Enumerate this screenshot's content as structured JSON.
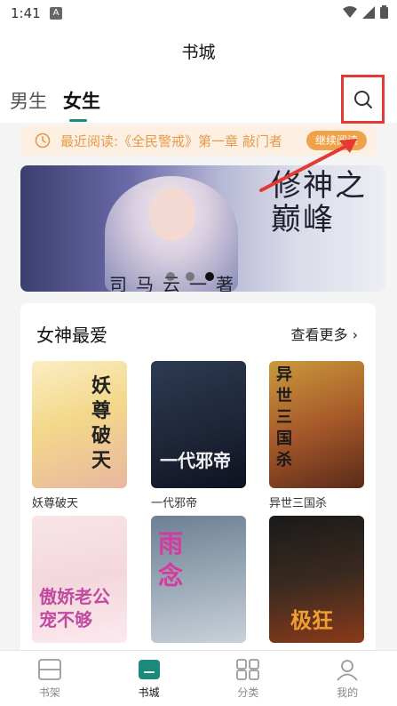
{
  "status_bar": {
    "time": "1:41",
    "badge": "A"
  },
  "header": {
    "title": "书城"
  },
  "tabs": [
    {
      "label": "男生"
    },
    {
      "label": "女生"
    }
  ],
  "recent": {
    "text": "最近阅读:《全民警戒》第一章 敲门者",
    "continue_label": "继续阅读"
  },
  "banner": {
    "title_vertical": "修神之巅峰",
    "author": "司马云一著"
  },
  "section": {
    "title": "女神最爱",
    "more_label": "查看更多",
    "books": [
      {
        "name": "妖尊破天",
        "cover_text": "妖尊破天"
      },
      {
        "name": "一代邪帝",
        "cover_text": "一代邪帝"
      },
      {
        "name": "异世三国杀",
        "cover_text": "异世三国杀"
      },
      {
        "name": "",
        "cover_text": "傲娇老公宠不够"
      },
      {
        "name": "",
        "cover_text": "雨念"
      },
      {
        "name": "",
        "cover_text": "极狂"
      }
    ]
  },
  "bottom_nav": [
    {
      "label": "书架",
      "icon": "bookshelf-icon"
    },
    {
      "label": "书城",
      "icon": "bookstore-icon"
    },
    {
      "label": "分类",
      "icon": "category-icon"
    },
    {
      "label": "我的",
      "icon": "profile-icon"
    }
  ],
  "colors": {
    "accent": "#1a8a7a",
    "highlight_red": "#e53935",
    "recent_text": "#e39a4b",
    "continue_bg": "#f0a24a"
  }
}
